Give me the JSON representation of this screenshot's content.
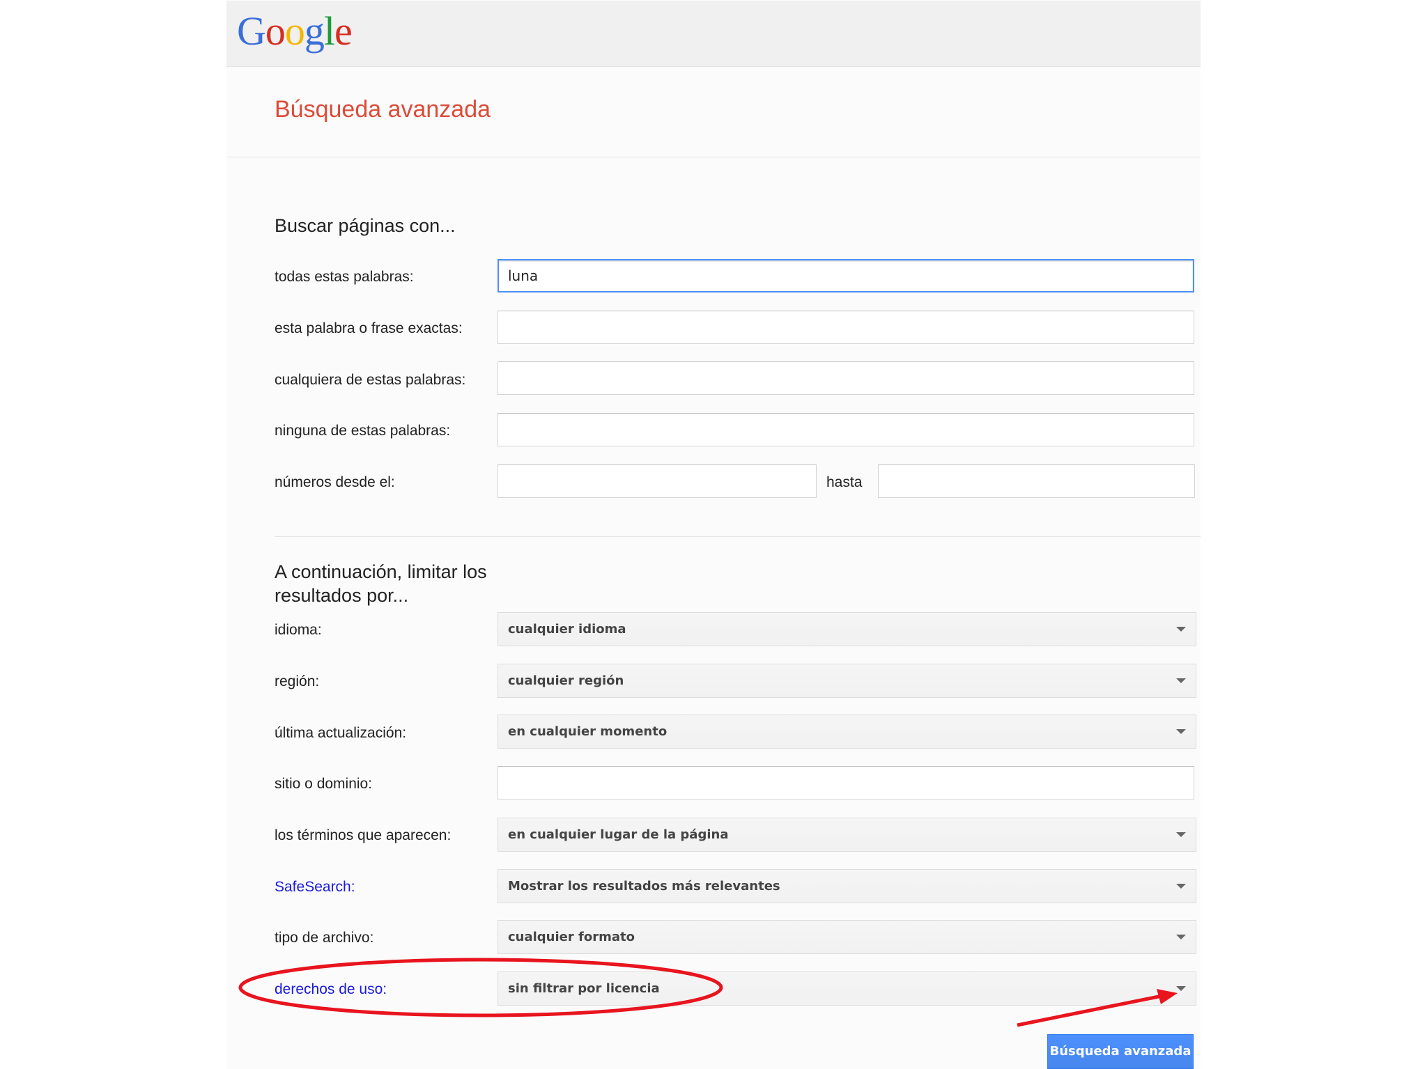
{
  "logo": {
    "letters": [
      "G",
      "o",
      "o",
      "g",
      "l",
      "e"
    ]
  },
  "page_title": "Búsqueda avanzada",
  "section1": {
    "heading": "Buscar páginas con...",
    "all_words": {
      "label": "todas estas palabras:",
      "value": "luna"
    },
    "exact_phrase": {
      "label": "esta palabra o frase exactas:",
      "value": ""
    },
    "any_words": {
      "label": "cualquiera de estas palabras:",
      "value": ""
    },
    "none_words": {
      "label": "ninguna de estas palabras:",
      "value": ""
    },
    "numbers": {
      "label": "números desde el:",
      "from_value": "",
      "to_label": "hasta",
      "to_value": ""
    }
  },
  "section2": {
    "heading": "A continuación, limitar los resultados por...",
    "language": {
      "label": "idioma:",
      "value": "cualquier idioma"
    },
    "region": {
      "label": "región:",
      "value": "cualquier región"
    },
    "last_update": {
      "label": "última actualización:",
      "value": "en cualquier momento"
    },
    "site": {
      "label": "sitio o dominio:",
      "value": ""
    },
    "terms_appear": {
      "label": "los términos que aparecen:",
      "value": "en cualquier lugar de la página"
    },
    "safesearch": {
      "label": "SafeSearch:",
      "value": "Mostrar los resultados más relevantes"
    },
    "file_type": {
      "label": "tipo de archivo:",
      "value": "cualquier formato"
    },
    "usage_rights": {
      "label": "derechos de uso:",
      "value": "sin filtrar por licencia"
    }
  },
  "submit_button": {
    "label": "Búsqueda avanzada"
  },
  "colors": {
    "title_red": "#dd4b39",
    "link_blue": "#1a1ade",
    "button_blue": "#4d90fe",
    "annotation_red": "#e8141e"
  }
}
